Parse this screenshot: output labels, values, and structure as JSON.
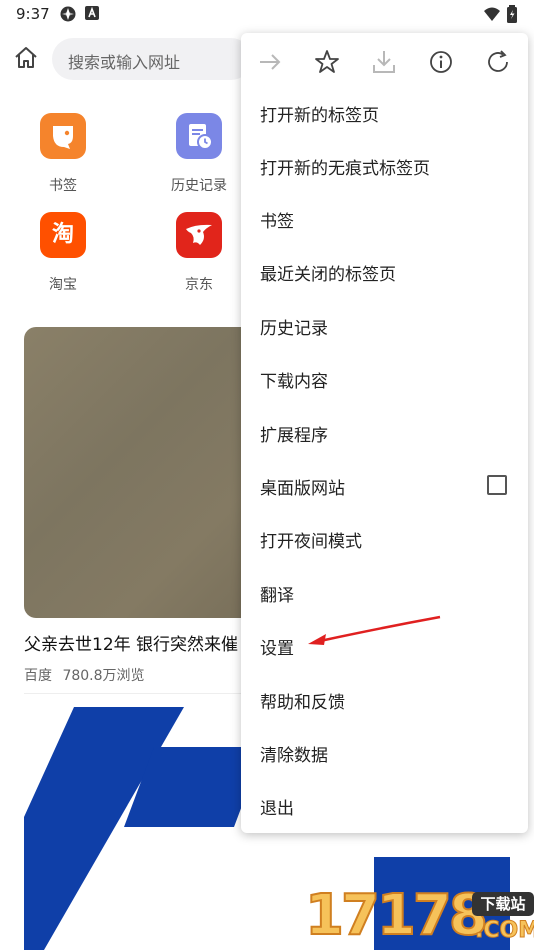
{
  "status_bar": {
    "time": "9:37"
  },
  "address_bar": {
    "placeholder": "搜索或输入网址"
  },
  "shortcuts": [
    {
      "label": "书签",
      "icon": "bookmark-icon",
      "color": "#f5842c"
    },
    {
      "label": "历史记录",
      "icon": "history-icon",
      "color": "#7b87e6"
    },
    {
      "label": "淘宝",
      "icon": "taobao-icon",
      "glyph": "淘",
      "color": "#ff5000"
    },
    {
      "label": "京东",
      "icon": "jd-icon",
      "color": "#e1251b"
    }
  ],
  "feed": [
    {
      "title": "父亲去世12年 银行突然来催",
      "source": "百度",
      "views": "780.8万浏览"
    }
  ],
  "menu": {
    "toolbar": [
      "forward-icon",
      "star-icon",
      "download-icon",
      "info-icon",
      "refresh-icon"
    ],
    "items": [
      {
        "label": "打开新的标签页"
      },
      {
        "label": "打开新的无痕式标签页"
      },
      {
        "label": "书签"
      },
      {
        "label": "最近关闭的标签页"
      },
      {
        "label": "历史记录"
      },
      {
        "label": "下载内容"
      },
      {
        "label": "扩展程序"
      },
      {
        "label": "桌面版网站",
        "checked": false
      },
      {
        "label": "打开夜间模式"
      },
      {
        "label": "翻译"
      },
      {
        "label": "设置"
      },
      {
        "label": "帮助和反馈"
      },
      {
        "label": "清除数据"
      },
      {
        "label": "退出"
      }
    ]
  },
  "watermark": {
    "number": "17178",
    "badge": "下载站",
    "domain": ".COM"
  },
  "colors": {
    "arrow": "#e02020",
    "feed_blue": "#0f3fa8"
  }
}
